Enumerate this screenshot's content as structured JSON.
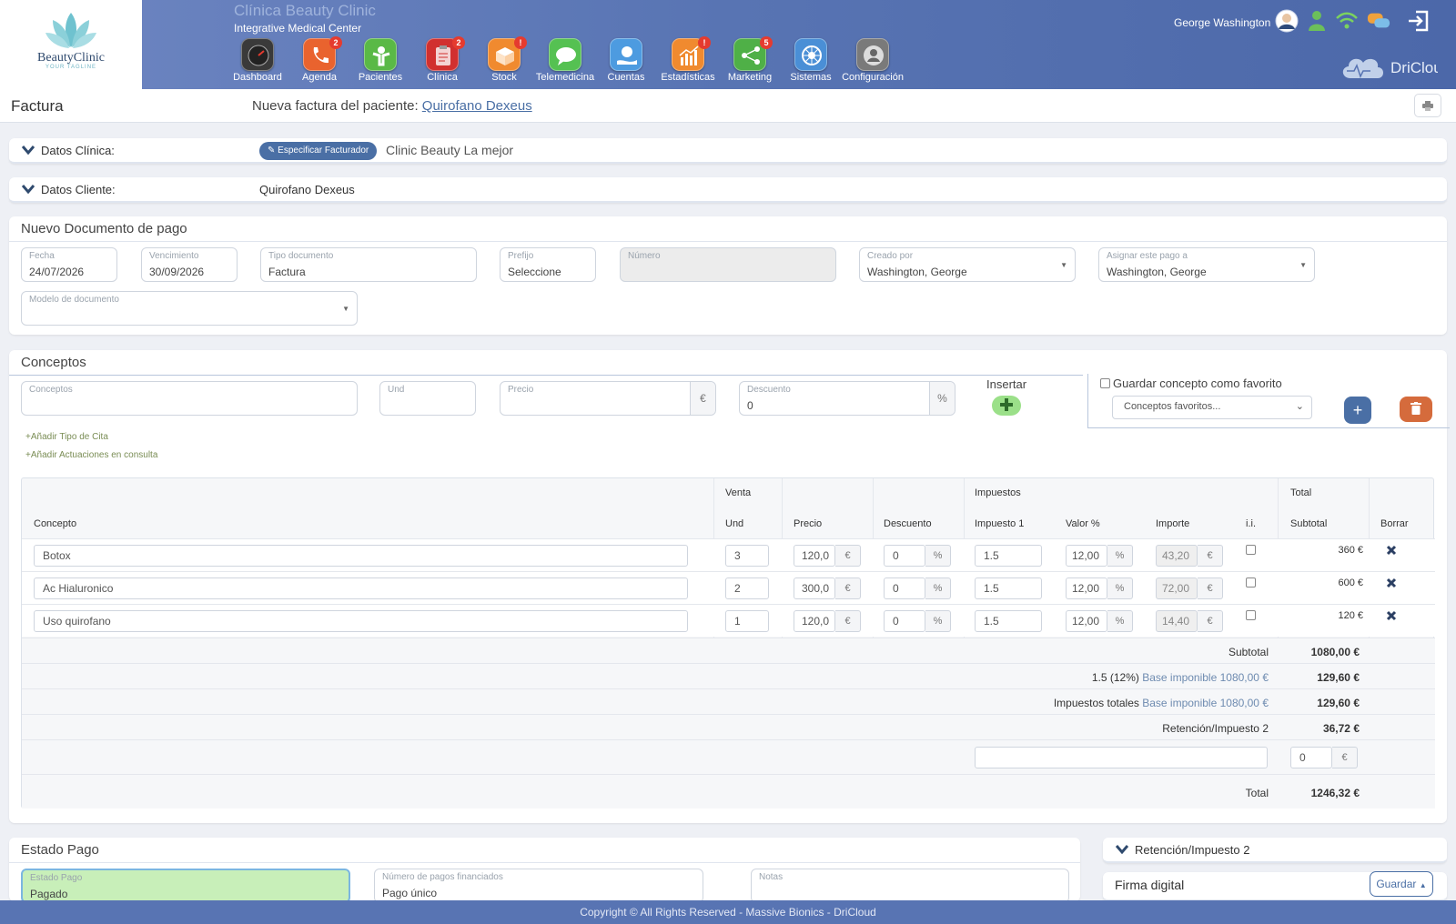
{
  "app": {
    "logo_name": "BeautyClinic",
    "logo_tagline": "YOUR TAGLINE",
    "clinic_title": "Clínica Beauty Clinic",
    "clinic_subtitle": "Integrative Medical Center",
    "user_name": "George Washington",
    "brand": "DriCloud",
    "accent_color": "#5874b3"
  },
  "nav": [
    {
      "label": "Dashboard",
      "icon": "dashboard-gauge-icon",
      "color": "#3a3a3a",
      "badge": ""
    },
    {
      "label": "Agenda",
      "icon": "phone-icon",
      "color": "#e9632e",
      "badge": "2"
    },
    {
      "label": "Pacientes",
      "icon": "patient-icon",
      "color": "#5ab946",
      "badge": ""
    },
    {
      "label": "Clínica",
      "icon": "clipboard-icon",
      "color": "#d1302f",
      "badge": "2"
    },
    {
      "label": "Stock",
      "icon": "box-icon",
      "color": "#f08a2f",
      "badge": "!"
    },
    {
      "label": "Telemedicina",
      "icon": "chat-icon",
      "color": "#55c152",
      "badge": ""
    },
    {
      "label": "Cuentas",
      "icon": "money-hand-icon",
      "color": "#4d9be0",
      "badge": ""
    },
    {
      "label": "Estadísticas",
      "icon": "chart-icon",
      "color": "#f08a2f",
      "badge": "!"
    },
    {
      "label": "Marketing",
      "icon": "share-icon",
      "color": "#4fb047",
      "badge": "5"
    },
    {
      "label": "Sistemas",
      "icon": "gear-wheel-icon",
      "color": "#4a8fd6",
      "badge": ""
    },
    {
      "label": "Configuración",
      "icon": "user-settings-icon",
      "color": "#7a7a7a",
      "badge": ""
    }
  ],
  "page": {
    "title": "Factura",
    "subtitle_prefix": "Nueva factura del paciente:",
    "patient_link": "Quirofano Dexeus"
  },
  "clinica": {
    "label": "Datos Clínica:",
    "button": "Especificar Facturador",
    "value": "Clinic Beauty La mejor"
  },
  "cliente": {
    "label": "Datos Cliente:",
    "value": "Quirofano Dexeus"
  },
  "documento": {
    "title": "Nuevo Documento de pago",
    "fecha": {
      "label": "Fecha",
      "value": "24/07/2026"
    },
    "vencimiento": {
      "label": "Vencimiento",
      "value": "30/09/2026"
    },
    "tipo": {
      "label": "Tipo documento",
      "value": "Factura"
    },
    "prefijo": {
      "label": "Prefijo",
      "value": "Seleccione"
    },
    "numero": {
      "label": "Número",
      "value": ""
    },
    "creado": {
      "label": "Creado por",
      "value": "Washington, George"
    },
    "asignar": {
      "label": "Asignar este pago a",
      "value": "Washington, George"
    },
    "modelo": {
      "label": "Modelo de documento",
      "value": ""
    }
  },
  "conceptos": {
    "title": "Conceptos",
    "concepto_ph": "Conceptos",
    "und_ph": "Und",
    "precio_ph": "Precio",
    "precio_unit": "€",
    "descuento_label": "Descuento",
    "descuento_value": "0",
    "descuento_unit": "%",
    "insertar": "Insertar",
    "fav_label": "Guardar concepto como favorito",
    "fav_select": "Conceptos favoritos...",
    "add_tipo_cita": "+Añadir Tipo de Cita",
    "add_actuaciones": "+Añadir Actuaciones en consulta"
  },
  "table": {
    "group_venta": "Venta",
    "group_impuestos": "Impuestos",
    "group_total": "Total",
    "headers": [
      "Concepto",
      "Und",
      "Precio",
      "Descuento",
      "Impuesto 1",
      "Valor %",
      "Importe",
      "i.i.",
      "Subtotal",
      "Borrar"
    ],
    "currency": "€",
    "percent": "%",
    "rows": [
      {
        "concepto": "Botox",
        "und": "3",
        "precio": "120,0",
        "descuento": "0",
        "impuesto": "1.5",
        "valor": "12,00",
        "importe": "43,20",
        "subtotal": "360 €"
      },
      {
        "concepto": "Ac Hialuronico",
        "und": "2",
        "precio": "300,0",
        "descuento": "0",
        "impuesto": "1.5",
        "valor": "12,00",
        "importe": "72,00",
        "subtotal": "600 €"
      },
      {
        "concepto": "Uso quirofano",
        "und": "1",
        "precio": "120,0",
        "descuento": "0",
        "impuesto": "1.5",
        "valor": "12,00",
        "importe": "14,40",
        "subtotal": "120 €"
      }
    ],
    "subtotal_label": "Subtotal",
    "subtotal_value": "1080,00 €",
    "tax_line_label": "1.5 (12%)",
    "tax_line_base": "Base imponible 1080,00 €",
    "tax_line_value": "129,60 €",
    "tax_total_label": "Impuestos totales",
    "tax_total_base": "Base imponible 1080,00 €",
    "tax_total_value": "129,60 €",
    "retencion_label": "Retención/Impuesto 2",
    "retencion_value": "36,72 €",
    "extra_value": "0",
    "total_label": "Total",
    "total_value": "1246,32 €"
  },
  "estado": {
    "title": "Estado Pago",
    "estado": {
      "label": "Estado Pago",
      "value": "Pagado"
    },
    "pagos": {
      "label": "Número de pagos financiados",
      "value": "Pago único"
    },
    "notas": {
      "label": "Notas",
      "value": ""
    },
    "retencion_toggle": "Retención/Impuesto 2",
    "firma": "Firma digital",
    "guardar": "Guardar"
  },
  "footer": {
    "text": "Copyright © All Rights Reserved - Massive Bionics - DriCloud"
  }
}
